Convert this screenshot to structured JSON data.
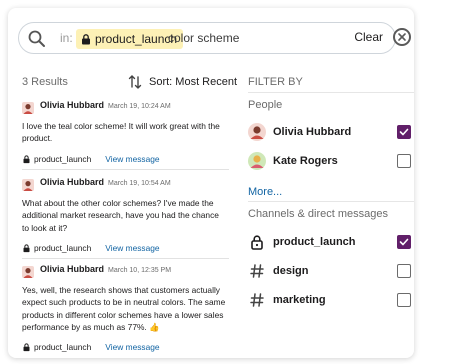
{
  "search": {
    "in_label": "in:",
    "channel_chip": "product_launch",
    "query": "color scheme",
    "clear_label": "Clear"
  },
  "results_header": {
    "count_label": "3 Results",
    "sort_label": "Sort: Most Recent"
  },
  "results": [
    {
      "author": "Olivia Hubbard",
      "time": "March 19, 10:24 AM",
      "body": "I love the teal color scheme! It will work great with the product.",
      "channel": "product_launch",
      "view_label": "View message"
    },
    {
      "author": "Olivia Hubbard",
      "time": "March 19, 10:54 AM",
      "body": "What about the other color schemes? I've made the additional market research, have you had the chance to look at it?",
      "channel": "product_launch",
      "view_label": "View message"
    },
    {
      "author": "Olivia Hubbard",
      "time": "March 10, 12:35 PM",
      "body": "Yes, well, the research shows that customers actually expect such products to be in neutral colors. The same products in different color schemes have a lower sales performance by as much as 77%. 👍",
      "channel": "product_launch",
      "view_label": "View message"
    }
  ],
  "filter": {
    "title": "FILTER BY",
    "people_title": "People",
    "people": [
      {
        "name": "Olivia Hubbard",
        "checked": true
      },
      {
        "name": "Kate Rogers",
        "checked": false
      }
    ],
    "more_label": "More...",
    "channels_title": "Channels & direct messages",
    "channels": [
      {
        "name": "product_launch",
        "icon": "lock-icon",
        "checked": true
      },
      {
        "name": "design",
        "icon": "hash-icon",
        "checked": false
      },
      {
        "name": "marketing",
        "icon": "hash-icon",
        "checked": false
      }
    ]
  },
  "colors": {
    "accent": "#611f69",
    "link": "#1264a3",
    "chip_bg": "#fdf1b6"
  }
}
